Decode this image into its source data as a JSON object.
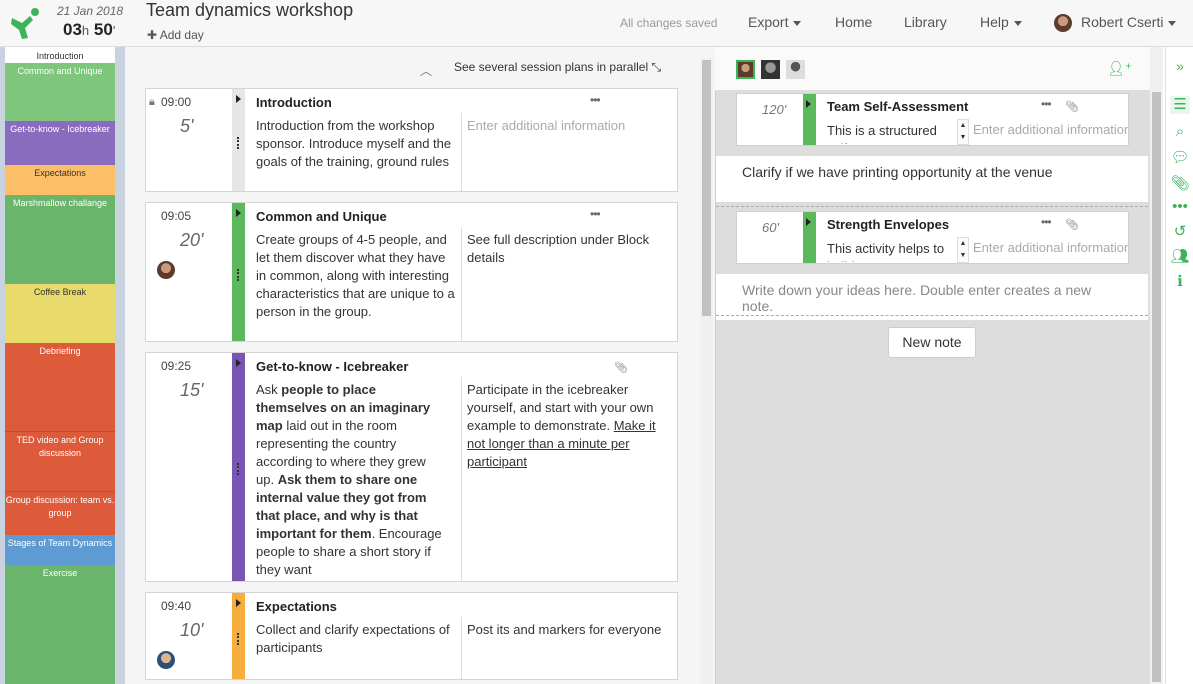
{
  "header": {
    "date": "21 Jan 2018",
    "duration_h": "03",
    "duration_h_unit": "h",
    "duration_m": "50",
    "duration_m_unit": "'",
    "title": "Team dynamics workshop",
    "add_day": "Add day",
    "saved_status": "All changes saved",
    "nav": {
      "export": "Export",
      "home": "Home",
      "library": "Library",
      "help": "Help",
      "user": "Robert Cserti"
    }
  },
  "sidebar": {
    "segments": [
      {
        "label": "Introduction",
        "color": "#ffffff"
      },
      {
        "label": "Common and Unique",
        "color": "#7dc67b"
      },
      {
        "label": "Get-to-know - Icebreaker",
        "color": "#8a6cbf"
      },
      {
        "label": "Expectations",
        "color": "#fbbf68"
      },
      {
        "label": "Marshmallow challange",
        "color": "#6ab56b"
      },
      {
        "label": "Coffee Break",
        "color": "#e8db6b"
      },
      {
        "label": "Debriefing",
        "color": "#dd5a3a"
      },
      {
        "label": "TED video and Group discussion",
        "color": "#dd5a3a"
      },
      {
        "label": "Group discussion: team vs. group",
        "color": "#dd5a3a"
      },
      {
        "label": "Stages of Team Dynamics",
        "color": "#5d9bd2"
      },
      {
        "label": "Exercise",
        "color": "#6ab56b"
      }
    ]
  },
  "center": {
    "parallel_label": "See several session plans in parallel",
    "blocks": [
      {
        "time": "09:00",
        "duration": "5'",
        "title": "Introduction",
        "color": "#e6e6e6",
        "desc": "Introduction from the workshop sponsor. Introduce myself and the goals of the training, ground rules",
        "info": "Enter additional information",
        "locked": true
      },
      {
        "time": "09:05",
        "duration": "20'",
        "title": "Common and Unique",
        "color": "#5cb85c",
        "desc": "Create groups of 4-5 people, and let them discover what they have in common, along with interesting characteristics that are unique to a person in the group.",
        "info": "See full description under Block details"
      },
      {
        "time": "09:25",
        "duration": "15'",
        "title": "Get-to-know - Icebreaker",
        "color": "#7a56b4",
        "desc_parts": [
          "Ask ",
          "people to place themselves on an imaginary map",
          " laid out in the room representing the country according to where they grew up.  ",
          "Ask them to share one internal value they got from that place, and why is that important for them",
          ". Encourage people to share a short story if they want"
        ],
        "info_parts": [
          "Participate in the icebreaker yourself, and start with your own example to demonstrate. ",
          "Make it not longer than a minute per participant"
        ]
      },
      {
        "time": "09:40",
        "duration": "10'",
        "title": "Expectations",
        "color": "#f7ad3b",
        "desc": "Collect and clarify expectations of participants",
        "info": "Post its and markers for everyone"
      }
    ]
  },
  "notes": {
    "cards": [
      {
        "duration": "120'",
        "title": "Team Self-Assessment",
        "desc": "This is a structured self-assessment",
        "info": "Enter additional information",
        "note": "Clarify if we have printing opportunity at the venue"
      },
      {
        "duration": "60'",
        "title": "Strength Envelopes",
        "desc": "This activity helps to build trust",
        "info": "Enter additional information",
        "note": "Write down your ideas here. Double enter creates a new note."
      }
    ],
    "new_note_label": "New note"
  },
  "icons": {
    "more": "ellipsis-icon",
    "clip": "paperclip-icon",
    "lock": "lock-icon"
  }
}
